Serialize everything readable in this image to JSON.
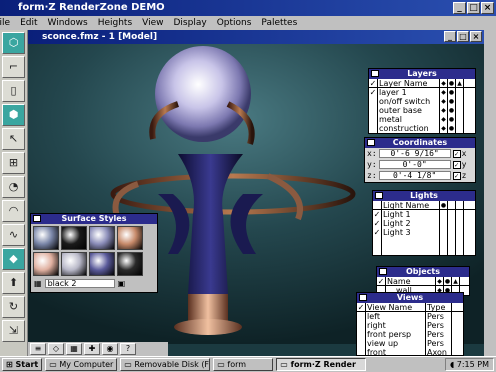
{
  "app": {
    "title": "form·Z RenderZone DEMO"
  },
  "menu": [
    "File",
    "Edit",
    "Windows",
    "Heights",
    "View",
    "Display",
    "Options",
    "Palettes"
  ],
  "doc": {
    "title": "sconce.fmz - 1 [Model]"
  },
  "layers": {
    "title": "Layers",
    "header": "Layer Name",
    "items": [
      "layer 1",
      "on/off switch",
      "outer base",
      "metal",
      "construction"
    ]
  },
  "coordinates": {
    "title": "Coordinates",
    "rows": [
      {
        "axis": "x:",
        "value": "0'-6 9/16\"",
        "flag": "x"
      },
      {
        "axis": "y:",
        "value": "0'-0\"",
        "flag": "y"
      },
      {
        "axis": "z:",
        "value": "0'-4 1/8\"",
        "flag": "z"
      }
    ]
  },
  "lights": {
    "title": "Lights",
    "header": "Light Name",
    "items": [
      "Light 1",
      "Light 2",
      "Light 3"
    ]
  },
  "objects": {
    "title": "Objects",
    "header": "Name",
    "items": [
      "wall"
    ]
  },
  "views": {
    "title": "Views",
    "header": "View Name",
    "type_header": "Type",
    "items": [
      {
        "name": "left",
        "type": "Pers"
      },
      {
        "name": "right",
        "type": "Pers"
      },
      {
        "name": "front persp",
        "type": "Pers"
      },
      {
        "name": "view up",
        "type": "Pers"
      },
      {
        "name": "front",
        "type": "Axon"
      }
    ]
  },
  "surface_styles": {
    "title": "Surface Styles",
    "selected": "black 2",
    "swatch_colors": [
      "#7a86a8",
      "#1a1a1a",
      "#8a8cb8",
      "#c78a6a",
      "#e0b0a0",
      "#b8b8c8",
      "#5a5a9a",
      "#2a2a2a"
    ]
  },
  "taskbar": {
    "start": "Start",
    "items": [
      "My Computer",
      "Removable Disk (F:)",
      "form",
      "form·Z Render"
    ],
    "clock": "7:15 PM"
  },
  "colors": {
    "titlebar": "#0a1f7a",
    "palette_title": "#2c2c8c",
    "viewport_bg": "#1b3a40"
  }
}
